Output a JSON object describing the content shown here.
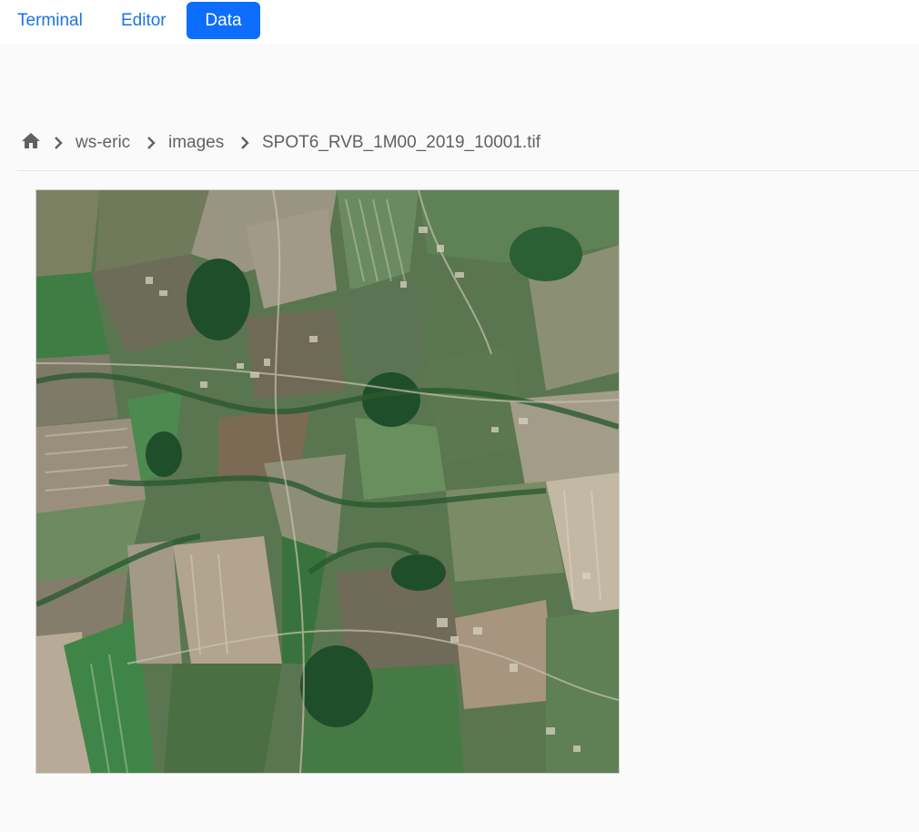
{
  "tabs": [
    {
      "label": "Terminal"
    },
    {
      "label": "Editor"
    },
    {
      "label": "Data"
    }
  ],
  "breadcrumb": {
    "home_icon": "home-icon",
    "separator_icon": "chevron-right-icon",
    "items": [
      "ws-eric",
      "images",
      "SPOT6_RVB_1M00_2019_10001.tif"
    ]
  },
  "colors": {
    "accent": "#0d6efd",
    "link": "#1a73e8",
    "text_muted": "#616161"
  }
}
